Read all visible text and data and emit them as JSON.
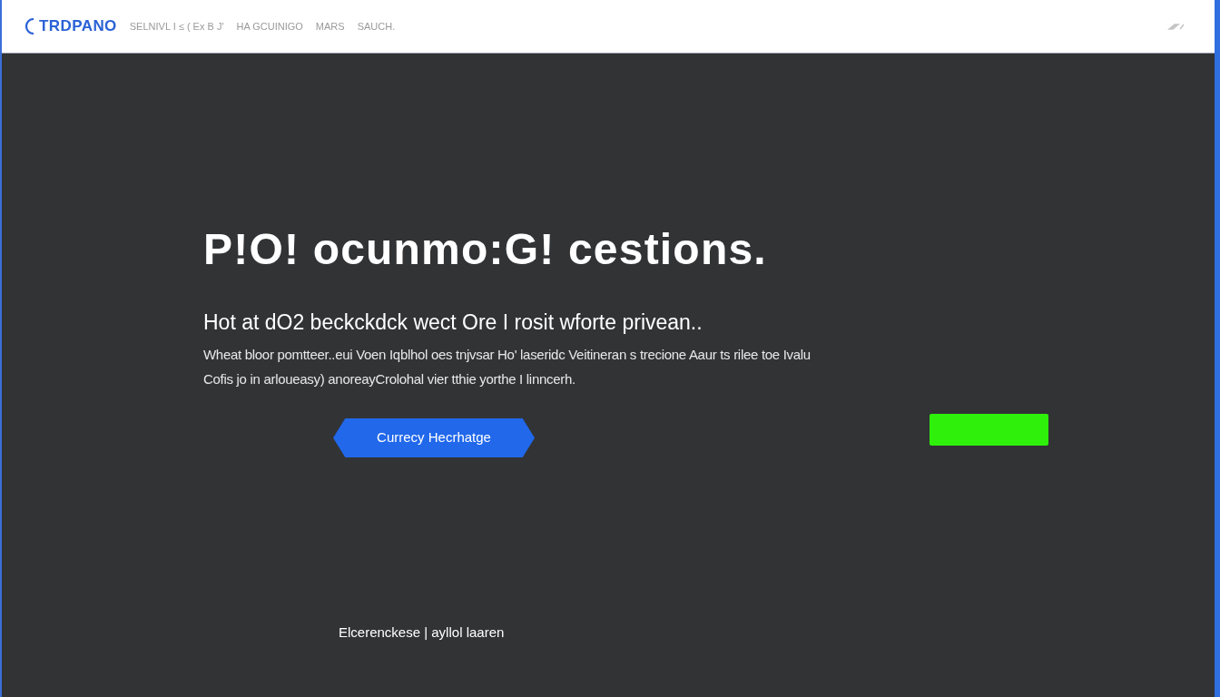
{
  "header": {
    "logo": "TRDPANO",
    "nav": [
      "SELNIVL  I ≤ ( Ex B J'",
      "HA GCUINIGO",
      "MARS",
      "SAUCH."
    ]
  },
  "hero": {
    "title": "P!O! ocunmo:G! cestions.",
    "subtitle": "Hot at dO2 beckckdck wect Ore I rosit wforte privean..",
    "body_lines": [
      "Wheat bloor pomtteer..eui Voen Iqblhol oes tnjvsar Ho' laseridc Veitineran s trecione Aaur ts rilee toe Ivalu",
      "Cofis jo in arloueasy) anoreayCrolohal vier tthie yorthe I linncerh."
    ],
    "button": "Currecy Hecrhatge"
  },
  "footer": "Elcerenckese | ayllol laaren"
}
